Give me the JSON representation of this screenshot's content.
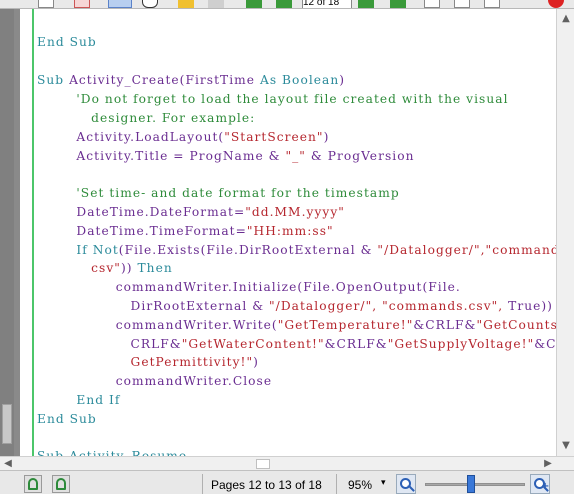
{
  "toolbar": {
    "page_field": "12 of 18",
    "icons": [
      "new-page-icon",
      "image-icon",
      "zoom-select-icon",
      "pan-hand-icon",
      "back-icon",
      "forward-icon",
      "first-page-icon",
      "previous-page-icon",
      "next-page-icon",
      "last-page-icon",
      "page-icon",
      "page-icon",
      "page-icon",
      "close-icon"
    ]
  },
  "colors": {
    "keyword": "#2a8a9a",
    "string": "#b5262e",
    "comment": "#2e8b3a",
    "identifier": "#6a2d91",
    "margin": "#4cc66a",
    "zoom_thumb": "#3a78d8"
  },
  "code": {
    "lines": [
      [
        {
          "t": "End Sub",
          "c": "kw"
        }
      ],
      [],
      [
        {
          "t": "Sub ",
          "c": "kw"
        },
        {
          "t": "Activity_Create(FirstTime ",
          "c": "txt"
        },
        {
          "t": "As Boolean",
          "c": "kw"
        },
        {
          "t": ")",
          "c": "txt"
        }
      ],
      [
        {
          "t": "        'Do not forget to load the layout file created with the visual",
          "c": "cmt"
        }
      ],
      [
        {
          "t": "           designer. For example:",
          "c": "cmt"
        }
      ],
      [
        {
          "t": "        Activity.LoadLayout(",
          "c": "txt"
        },
        {
          "t": "\"StartScreen\"",
          "c": "str"
        },
        {
          "t": ")",
          "c": "txt"
        }
      ],
      [
        {
          "t": "        Activity.Title = ProgName & ",
          "c": "txt"
        },
        {
          "t": "\"_\"",
          "c": "str"
        },
        {
          "t": " & ProgVersion",
          "c": "txt"
        }
      ],
      [],
      [
        {
          "t": "        'Set time- and date format for the timestamp",
          "c": "cmt"
        }
      ],
      [
        {
          "t": "        DateTime.DateFormat=",
          "c": "txt"
        },
        {
          "t": "\"dd.MM.yyyy\"",
          "c": "str"
        }
      ],
      [
        {
          "t": "        DateTime.TimeFormat=",
          "c": "txt"
        },
        {
          "t": "\"HH:mm:ss\"",
          "c": "str"
        }
      ],
      [
        {
          "t": "        If Not",
          "c": "kw"
        },
        {
          "t": "(File.Exists(File.DirRootExternal & ",
          "c": "txt"
        },
        {
          "t": "\"/Datalogger/\",\"commands.",
          "c": "str"
        }
      ],
      [
        {
          "t": "           csv\"",
          "c": "str"
        },
        {
          "t": ")) ",
          "c": "txt"
        },
        {
          "t": "Then",
          "c": "kw"
        }
      ],
      [
        {
          "t": "                commandWriter.Initialize(File.OpenOutput(File.",
          "c": "txt"
        }
      ],
      [
        {
          "t": "                   DirRootExternal & ",
          "c": "txt"
        },
        {
          "t": "\"/Datalogger/\", \"commands.csv\",",
          "c": "str"
        },
        {
          "t": " True))",
          "c": "txt"
        }
      ],
      [
        {
          "t": "                commandWriter.Write(",
          "c": "txt"
        },
        {
          "t": "\"GetTemperature!\"",
          "c": "str"
        },
        {
          "t": "&CRLF&",
          "c": "txt"
        },
        {
          "t": "\"GetCounts!\"",
          "c": "str"
        },
        {
          "t": "&",
          "c": "txt"
        }
      ],
      [
        {
          "t": "                   CRLF&",
          "c": "txt"
        },
        {
          "t": "\"GetWaterContent!\"",
          "c": "str"
        },
        {
          "t": "&CRLF&",
          "c": "txt"
        },
        {
          "t": "\"GetSupplyVoltage!\"",
          "c": "str"
        },
        {
          "t": "&CRLF&",
          "c": "txt"
        }
      ],
      [
        {
          "t": "                   GetPermittivity!\"",
          "c": "str"
        },
        {
          "t": ")",
          "c": "txt"
        }
      ],
      [
        {
          "t": "                commandWriter.Close",
          "c": "txt"
        }
      ],
      [
        {
          "t": "        End If",
          "c": "kw"
        }
      ],
      [
        {
          "t": "End Sub",
          "c": "kw"
        }
      ],
      [],
      [
        {
          "t": "Sub Activity_Resume",
          "c": "kw"
        }
      ]
    ]
  },
  "status": {
    "pages_text": "Pages 12 to 13 of 18",
    "zoom_value": "95%",
    "zoom_caret": "▾",
    "zoom_level_percent": 95
  },
  "scroll": {
    "up_arrow": "▲",
    "down_arrow": "▼",
    "left_arrow": "◀",
    "right_arrow": "▶"
  }
}
